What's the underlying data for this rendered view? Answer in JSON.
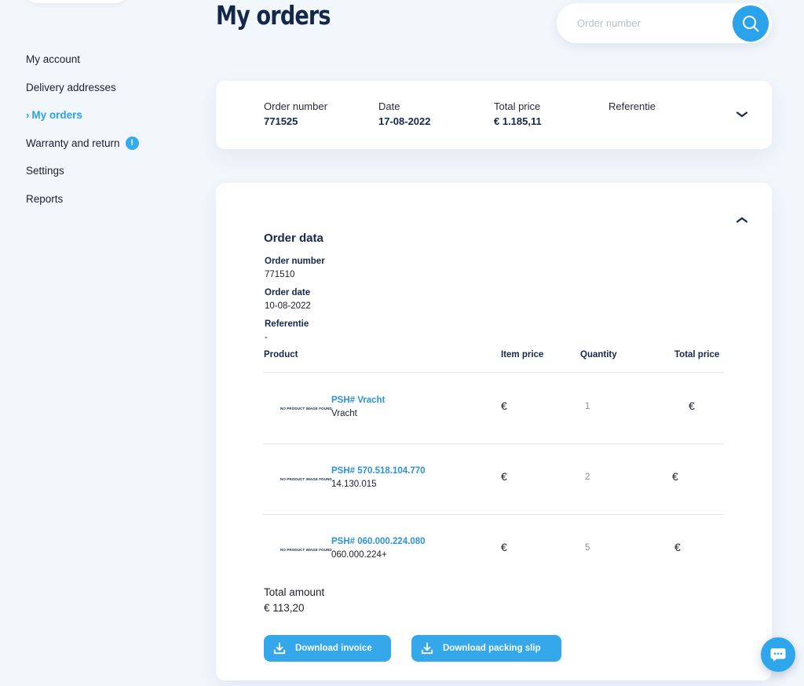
{
  "page": {
    "title": "My orders"
  },
  "search": {
    "placeholder": "Order number"
  },
  "sidebar": {
    "items": [
      {
        "label": "My account"
      },
      {
        "label": "Delivery addresses"
      },
      {
        "label": "My orders",
        "active": true
      },
      {
        "label": "Warranty and return",
        "badge": "!"
      },
      {
        "label": "Settings"
      },
      {
        "label": "Reports"
      }
    ]
  },
  "order_summary": {
    "order_number_label": "Order number",
    "order_number": "771525",
    "date_label": "Date",
    "date": "17-08-2022",
    "total_price_label": "Total price",
    "total_price": "€ 1.185,11",
    "referentie_label": "Referentie",
    "referentie": ""
  },
  "order_detail": {
    "section_title": "Order data",
    "order_number_label": "Order number",
    "order_number": "771510",
    "order_date_label": "Order date",
    "order_date": "10-08-2022",
    "referentie_label": "Referentie",
    "referentie": "-",
    "columns": {
      "product": "Product",
      "item_price": "Item price",
      "quantity": "Quantity",
      "total_price": "Total price"
    },
    "products": [
      {
        "image_text": "NO PRODUCT IMAGE FOUND",
        "name": "PSH# Vracht",
        "sub": "Vracht",
        "item_price": "€",
        "quantity": "1",
        "total_price": "€"
      },
      {
        "image_text": "NO PRODUCT IMAGE FOUND",
        "name": "PSH# 570.518.104.770",
        "sub": "14.130.015",
        "item_price": "€",
        "quantity": "2",
        "total_price": "€"
      },
      {
        "image_text": "NO PRODUCT IMAGE FOUND",
        "name": "PSH# 060.000.224.080",
        "sub": "060.000.224+",
        "item_price": "€",
        "quantity": "5",
        "total_price": "€"
      }
    ],
    "total_amount_label": "Total amount",
    "total_amount": "€ 113,20",
    "download_invoice": "Download invoice",
    "download_packing_slip": "Download packing slip"
  },
  "icons": {
    "search": "search-icon",
    "chevron_down": "chevron-down-icon",
    "chevron_up": "chevron-up-icon",
    "download": "download-icon",
    "chat": "chat-icon",
    "warning": "warning-badge-icon"
  },
  "colors": {
    "accent": "#2ba3ea",
    "title": "#14284b",
    "background": "#f2f7fc"
  }
}
